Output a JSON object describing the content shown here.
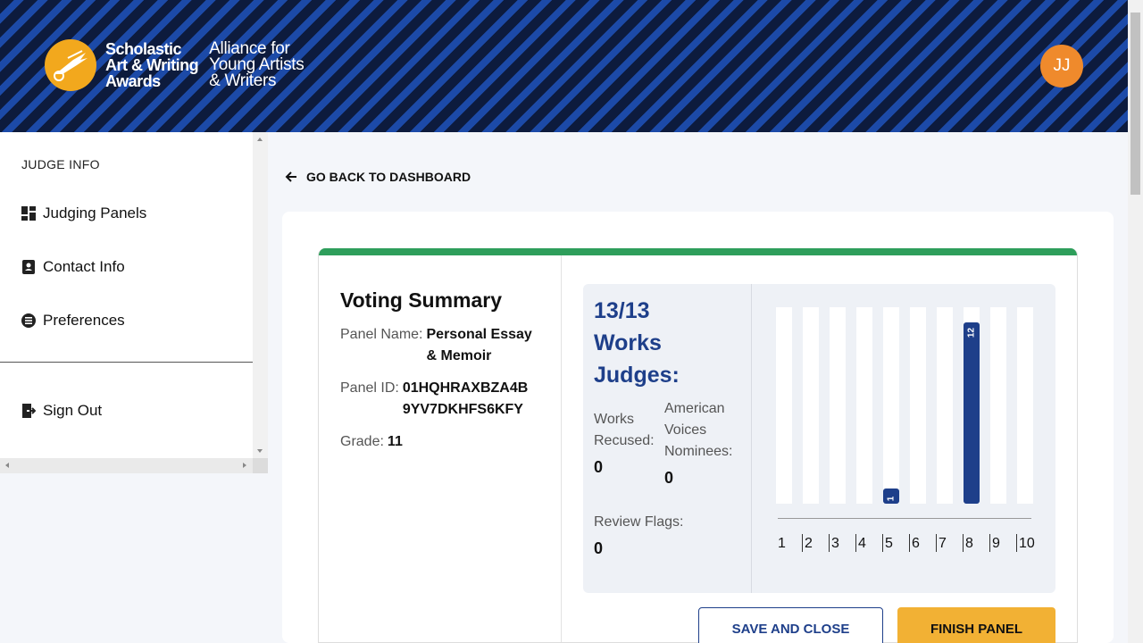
{
  "header": {
    "logo_main": [
      "Scholastic",
      "Art & Writing",
      "Awards"
    ],
    "logo_sub": [
      "Alliance for",
      "Young Artists",
      "& Writers"
    ],
    "avatar_initials": "JJ"
  },
  "sidebar": {
    "title": "JUDGE INFO",
    "items": [
      {
        "label": "Judging Panels",
        "icon": "dashboard-grid-icon"
      },
      {
        "label": "Contact Info",
        "icon": "contact-book-icon"
      },
      {
        "label": "Preferences",
        "icon": "preferences-list-icon"
      }
    ],
    "sign_out": {
      "label": "Sign Out",
      "icon": "sign-out-icon"
    }
  },
  "main": {
    "back_link": "GO BACK TO DASHBOARD",
    "summary": {
      "title": "Voting Summary",
      "panel_name_label": "Panel Name:",
      "panel_name": "Personal Essay & Memoir",
      "panel_id_label": "Panel ID:",
      "panel_id": "01HQHRAXBZA4B9YV7DKHFS6KFY",
      "grade_label": "Grade:",
      "grade": "11"
    },
    "stats": {
      "works_count": "13/13",
      "works_label": "Works Judges:",
      "recused_label": "Works Recused:",
      "recused_value": "0",
      "american_voices_label": "American Voices Nominees:",
      "american_voices_value": "0",
      "review_flags_label": "Review Flags:",
      "review_flags_value": "0"
    },
    "buttons": {
      "save": "SAVE AND CLOSE",
      "finish": "FINISH PANEL"
    }
  },
  "colors": {
    "accent_blue": "#1e3f8a",
    "header_stripe_dark": "#0d1b3d",
    "header_stripe_blue": "#1c4aa8",
    "logo_gold": "#f2a81d",
    "avatar_orange": "#ef8a2c",
    "panel_green": "#2e9e5b",
    "finish_gold": "#f2b134"
  },
  "chart_data": {
    "type": "bar",
    "categories": [
      "1",
      "2",
      "3",
      "4",
      "5",
      "6",
      "7",
      "8",
      "9",
      "10"
    ],
    "values": [
      0,
      0,
      0,
      0,
      1,
      0,
      0,
      12,
      0,
      0
    ],
    "ylim": [
      0,
      13
    ],
    "grid": false
  }
}
